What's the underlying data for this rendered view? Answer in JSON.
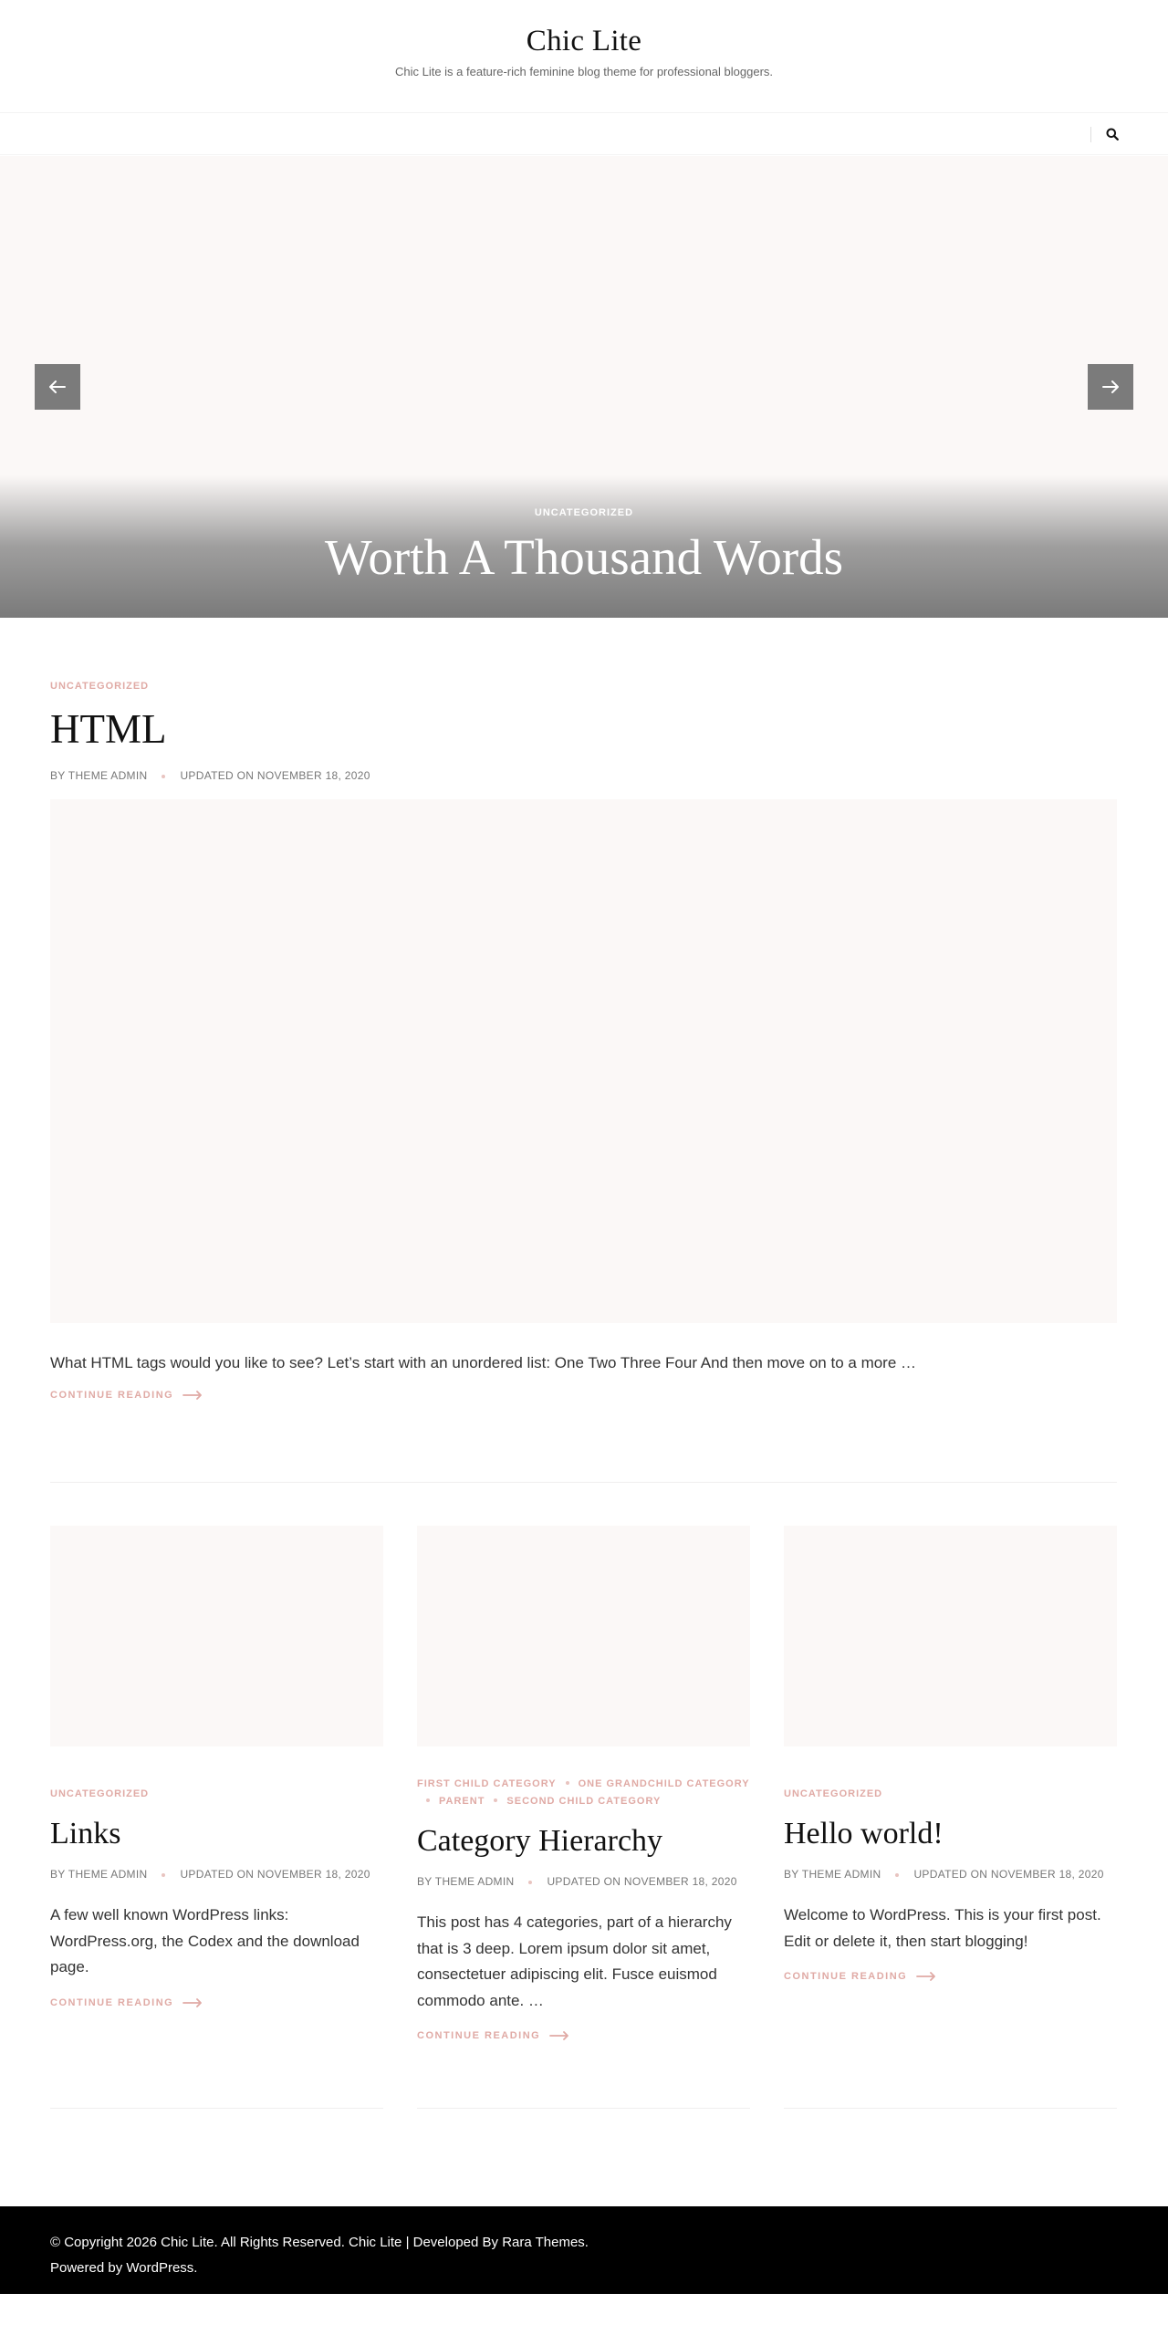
{
  "site": {
    "title": "Chic Lite",
    "description": "Chic Lite is a feature-rich feminine blog theme for professional bloggers."
  },
  "hero": {
    "category": "UNCATEGORIZED",
    "title": "Worth A Thousand Words"
  },
  "icons": {
    "search": "search-icon",
    "prev": "arrow-left-icon",
    "next": "arrow-right-icon",
    "continue": "long-arrow-right-icon"
  },
  "colors": {
    "accent": "#e0aaa5",
    "placeholder": "#fbf8f7",
    "footer_bg": "#000000",
    "arrow_bg": "#7b7b7b"
  },
  "featured_post": {
    "category": "UNCATEGORIZED",
    "title": "HTML",
    "author": "BY THEME ADMIN",
    "updated": "UPDATED ON NOVEMBER 18, 2020",
    "excerpt": "What HTML tags would you like to see? Let’s start with an unordered list: One Two Three Four And then move on to a more …",
    "continue": "CONTINUE READING"
  },
  "posts": [
    {
      "categories": [
        "UNCATEGORIZED"
      ],
      "title": "Links",
      "author": "BY THEME ADMIN",
      "updated": "UPDATED ON NOVEMBER 18, 2020",
      "excerpt": "A few well known WordPress links: WordPress.org, the Codex and the download page.",
      "continue": "CONTINUE READING"
    },
    {
      "categories": [
        "FIRST CHILD CATEGORY",
        "ONE GRANDCHILD CATEGORY",
        "PARENT",
        "SECOND CHILD CATEGORY"
      ],
      "title": "Category Hierarchy",
      "author": "BY THEME ADMIN",
      "updated": "UPDATED ON NOVEMBER 18, 2020",
      "excerpt": "This post has 4 categories, part of a hierarchy that is 3 deep. Lorem ipsum dolor sit amet, consectetuer adipiscing elit. Fusce euismod commodo ante. …",
      "continue": "CONTINUE READING"
    },
    {
      "categories": [
        "UNCATEGORIZED"
      ],
      "title": "Hello world!",
      "author": "BY THEME ADMIN",
      "updated": "UPDATED ON NOVEMBER 18, 2020",
      "excerpt": "Welcome to WordPress. This is your first post. Edit or delete it, then start blogging!",
      "continue": "CONTINUE READING"
    }
  ],
  "footer": {
    "text": "© Copyright 2026 Chic Lite. All Rights Reserved. Chic Lite | Developed By Rara Themes. Powered by WordPress."
  }
}
